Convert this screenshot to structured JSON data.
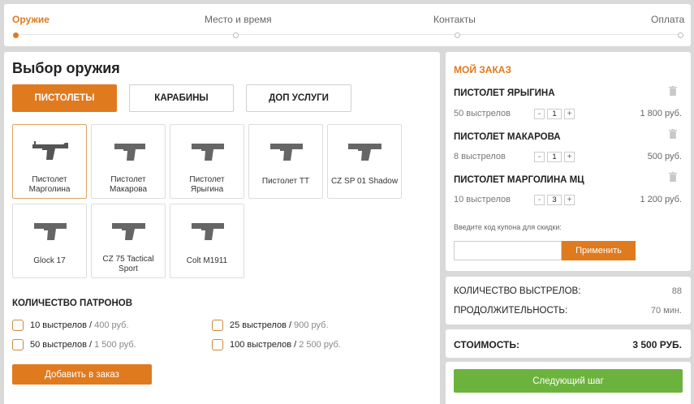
{
  "steps": [
    {
      "label": "Оружие",
      "active": true
    },
    {
      "label": "Место и время",
      "active": false
    },
    {
      "label": "Контакты",
      "active": false
    },
    {
      "label": "Оплата",
      "active": false
    }
  ],
  "main": {
    "title": "Выбор оружия",
    "tabs": [
      {
        "label": "ПИСТОЛЕТЫ",
        "active": true
      },
      {
        "label": "КАРАБИНЫ",
        "active": false
      },
      {
        "label": "ДОП УСЛУГИ",
        "active": false
      }
    ],
    "weapons": [
      {
        "name": "Пистолет Марголина",
        "icon": "pistol-margolin-icon"
      },
      {
        "name": "Пистолет Макарова",
        "icon": "pistol-makarov-icon"
      },
      {
        "name": "Пистолет Ярыгина",
        "icon": "pistol-yarygin-icon"
      },
      {
        "name": "Пистолет ТТ",
        "icon": "pistol-tt-icon"
      },
      {
        "name": "CZ SP 01 Shadow",
        "icon": "pistol-cz-shadow-icon"
      },
      {
        "name": "Glock 17",
        "icon": "pistol-glock-icon"
      },
      {
        "name": "CZ 75 Tactical Sport",
        "icon": "pistol-cz75-icon"
      },
      {
        "name": "Colt M1911",
        "icon": "pistol-colt-icon"
      }
    ],
    "ammo_title": "КОЛИЧЕСТВО ПАТРОНОВ",
    "ammo_options": [
      {
        "shots": "10 выстрелов",
        "sep": " / ",
        "price": "400 руб."
      },
      {
        "shots": "25 выстрелов",
        "sep": " / ",
        "price": "900 руб."
      },
      {
        "shots": "50 выстрелов",
        "sep": " / ",
        "price": "1 500 руб."
      },
      {
        "shots": "100 выстрелов",
        "sep": " / ",
        "price": "2 500 руб."
      }
    ],
    "add_button": "Добавить в заказ"
  },
  "order": {
    "title": "МОЙ ЗАКАЗ",
    "items": [
      {
        "name": "ПИСТОЛЕТ ЯРЫГИНА",
        "shots": "50 выстрелов",
        "qty": "1",
        "price": "1 800 руб."
      },
      {
        "name": "ПИСТОЛЕТ МАКАРОВА",
        "shots": "8 выстрелов",
        "qty": "1",
        "price": "500 руб."
      },
      {
        "name": "ПИСТОЛЕТ МАРГОЛИНА МЦ",
        "shots": "10 выстрелов",
        "qty": "3",
        "price": "1 200 руб."
      }
    ],
    "minus": "-",
    "plus": "+",
    "coupon_hint": "Введите код купона для скидки:",
    "coupon_value": "",
    "apply_button": "Применить"
  },
  "summary": {
    "shots_label": "КОЛИЧЕСТВО ВЫСТРЕЛОВ:",
    "shots_value": "88",
    "duration_label": "ПРОДОЛЖИТЕЛЬНОСТЬ:",
    "duration_value": "70 мин."
  },
  "cost": {
    "label": "СТОИМОСТЬ:",
    "value": "3 500 РУБ."
  },
  "next_button": "Следующий шаг",
  "colors": {
    "accent": "#e07a1f",
    "green": "#6cb33e",
    "background": "#d9d9d9"
  }
}
